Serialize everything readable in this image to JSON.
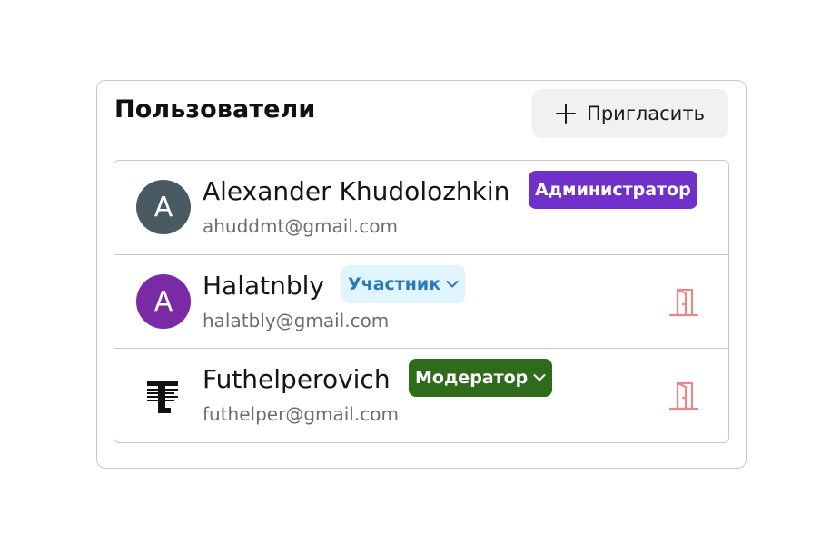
{
  "card": {
    "title": "Пользователи",
    "invite_label": "Пригласить",
    "invite_icon": "plus-icon"
  },
  "users": [
    {
      "initial": "A",
      "avatar_color": "#4a5a63",
      "name": "Alexander Khudolozhkin",
      "email": "ahuddmt@gmail.com",
      "role": "Администратор",
      "role_color": "#6f31c9",
      "role_editable": false,
      "can_remove": false
    },
    {
      "initial": "A",
      "avatar_color": "#7b2aa6",
      "name": "Halatnbly",
      "email": "halatbly@gmail.com",
      "role": "Участник",
      "role_color": "#dff4fd",
      "role_editable": true,
      "can_remove": true,
      "remove_icon": "door-exit-icon"
    },
    {
      "avatar_icon": "brand-logo-icon",
      "name": "Futhelperovich",
      "email": "futhelper@gmail.com",
      "role": "Модератор",
      "role_color": "#2e6b1a",
      "role_editable": true,
      "can_remove": true,
      "remove_icon": "door-exit-icon"
    }
  ],
  "colors": {
    "remove_icon": "#e58a8a",
    "border": "#c9c9c9"
  }
}
